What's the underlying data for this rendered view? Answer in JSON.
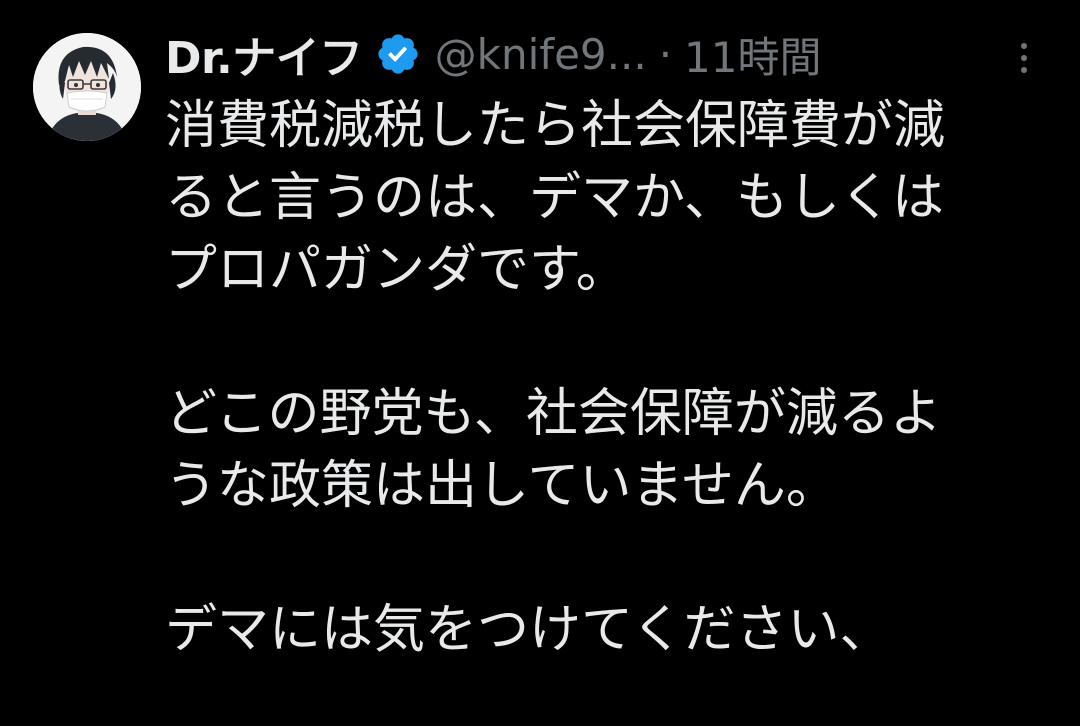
{
  "tweet": {
    "author": {
      "display_name": "Dr.ナイフ",
      "handle": "@knife9...",
      "verified": true,
      "avatar_icon": "anime-avatar-with-mask-icon"
    },
    "separator": "·",
    "time": "11時間",
    "more_icon": "more-vertical-icon",
    "lines": [
      "消費税減税したら社会保障費が減",
      "ると言うのは、デマか、もしくは",
      "プロパガンダです。",
      "",
      "どこの野党も、社会保障が減るよ",
      "うな政策は出していません。",
      "",
      "デマには気をつけてください、"
    ]
  },
  "colors": {
    "background": "#000000",
    "text": "#e7e9ea",
    "secondary_text": "#71767b",
    "verified_badge": "#1d9bf0"
  }
}
